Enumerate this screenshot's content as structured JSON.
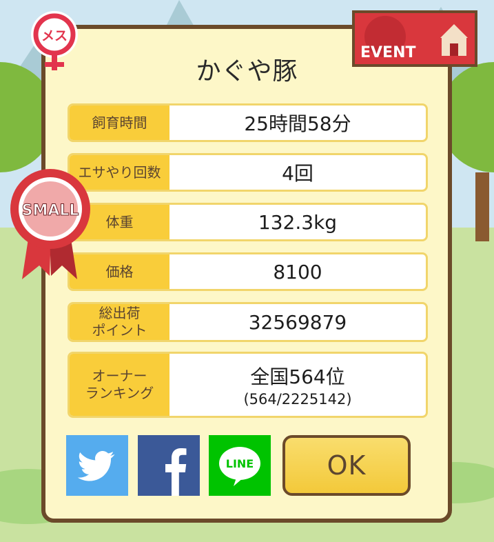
{
  "pig": {
    "name": "かぐや豚",
    "gender_label": "メス",
    "size_badge": "SMALL",
    "event_label": "EVENT"
  },
  "stats": [
    {
      "label": "飼育時間",
      "value": "25時間58分"
    },
    {
      "label": "エサやり回数",
      "value": "4回"
    },
    {
      "label": "体重",
      "value": "132.3kg"
    },
    {
      "label": "価格",
      "value": "8100"
    },
    {
      "label": "総出荷\nポイント",
      "value": "32569879"
    },
    {
      "label": "オーナー\nランキング",
      "value": "全国564位",
      "sub": "(564/2225142)"
    }
  ],
  "share": {
    "twitter_icon": "twitter-bird-icon",
    "facebook_icon": "facebook-f-icon",
    "line_label": "LINE"
  },
  "ok_label": "OK",
  "colors": {
    "frame": "#6b4a2a",
    "panel": "#fdf7c8",
    "label_bg": "#f9cd3a",
    "twitter": "#55acee",
    "facebook": "#3b5998",
    "line": "#00c300",
    "ribbon": "#d9373d"
  }
}
